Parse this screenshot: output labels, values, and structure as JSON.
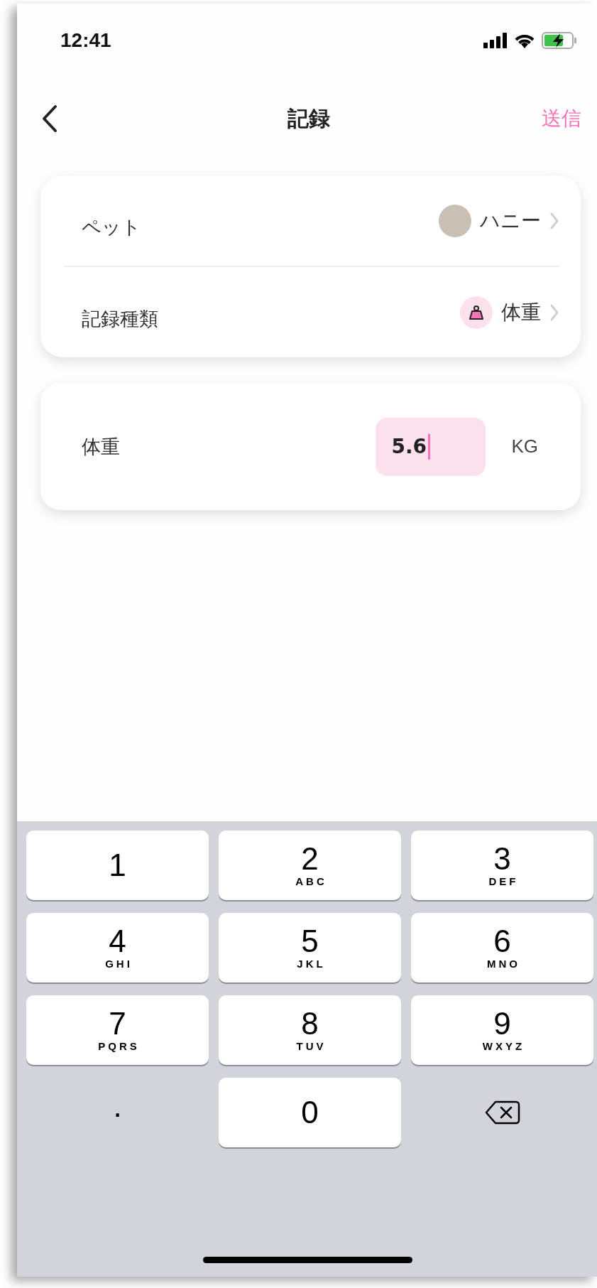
{
  "status_bar": {
    "time": "12:41"
  },
  "nav": {
    "title": "記録",
    "action": "送信"
  },
  "selection_card": {
    "rows": [
      {
        "kind": "pet",
        "label": "ペット",
        "value": "ハニー"
      },
      {
        "kind": "record_type",
        "label": "記録種類",
        "value": "体重"
      }
    ]
  },
  "entry_card": {
    "label": "体重",
    "input": {
      "value": "5.6",
      "focused": true
    },
    "unit": "KG"
  },
  "keypad": {
    "rows": [
      {
        "keys": [
          {
            "kind": "digit",
            "digit": "1"
          },
          {
            "kind": "digit",
            "digit": "2",
            "letters": "ABC"
          },
          {
            "kind": "digit",
            "digit": "3",
            "letters": "DEF"
          }
        ]
      },
      {
        "keys": [
          {
            "kind": "digit",
            "digit": "4",
            "letters": "GHI"
          },
          {
            "kind": "digit",
            "digit": "5",
            "letters": "JKL"
          },
          {
            "kind": "digit",
            "digit": "6",
            "letters": "MNO"
          }
        ]
      },
      {
        "keys": [
          {
            "kind": "digit",
            "digit": "7",
            "letters": "PQRS"
          },
          {
            "kind": "digit",
            "digit": "8",
            "letters": "TUV"
          },
          {
            "kind": "digit",
            "digit": "9",
            "letters": "WXYZ"
          }
        ]
      },
      {
        "keys": [
          {
            "kind": "symbol",
            "digit": "."
          },
          {
            "kind": "digit",
            "digit": "0"
          },
          {
            "kind": "delete"
          }
        ]
      }
    ]
  }
}
